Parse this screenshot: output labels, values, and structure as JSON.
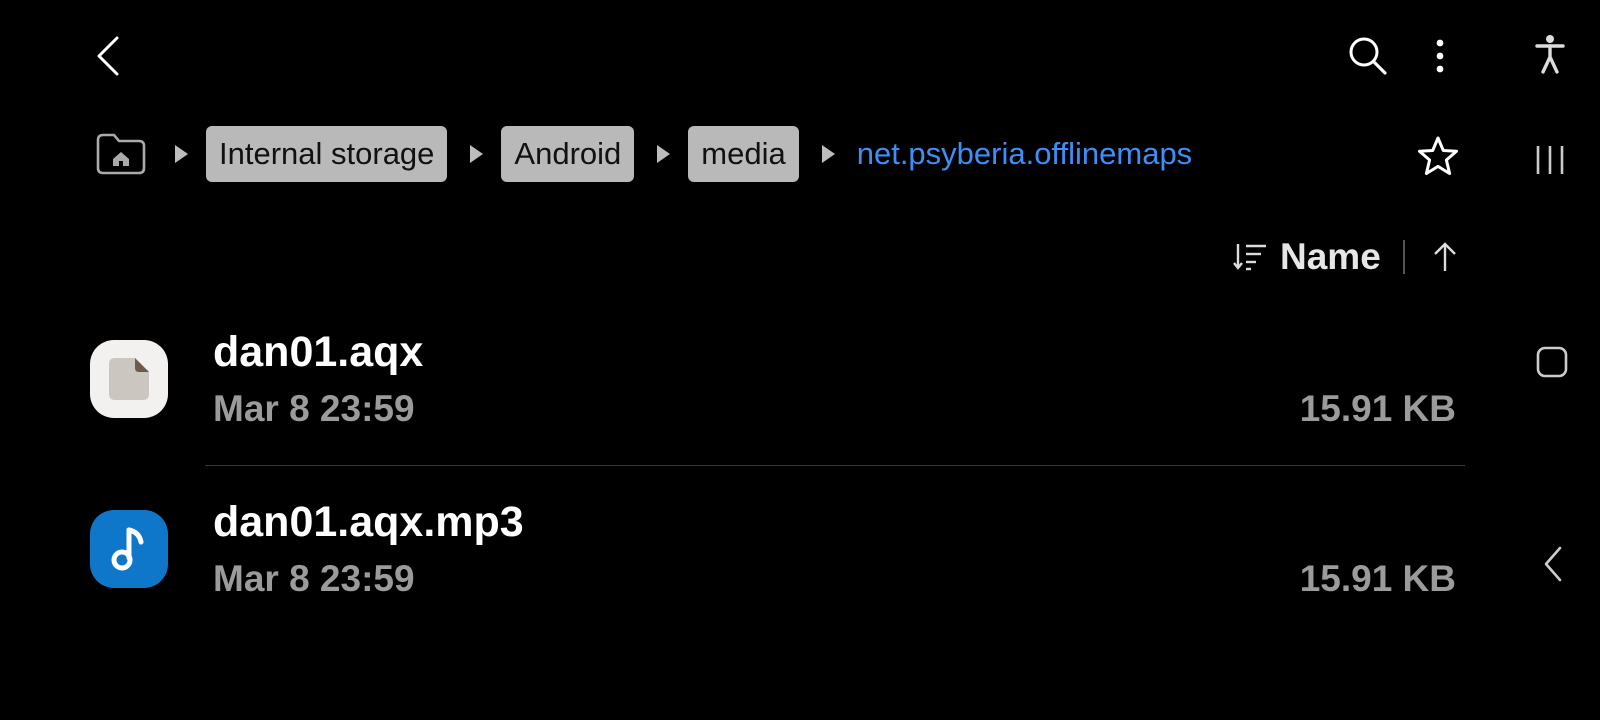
{
  "toolbar": {
    "back_icon": "chevron-left-icon",
    "search_icon": "search-icon",
    "more_icon": "more-vert-icon",
    "accessibility_icon": "accessibility-icon"
  },
  "breadcrumb": {
    "home_icon": "folder-home-icon",
    "items": [
      {
        "label": "Internal storage"
      },
      {
        "label": "Android"
      },
      {
        "label": "media"
      },
      {
        "label": "net.psyberia.offlinemaps",
        "current": true
      }
    ],
    "favorite_icon": "star-outline-icon"
  },
  "sort": {
    "label": "Name",
    "direction": "ascending"
  },
  "files": [
    {
      "name": "dan01.aqx",
      "date": "Mar 8 23:59",
      "size": "15.91 KB",
      "icon": "document-icon"
    },
    {
      "name": "dan01.aqx.mp3",
      "date": "Mar 8 23:59",
      "size": "15.91 KB",
      "icon": "music-note-icon"
    }
  ],
  "system_nav": {
    "recents_icon": "recents-icon",
    "home_icon": "home-icon",
    "back_icon": "back-icon"
  },
  "colors": {
    "background": "#000000",
    "accent": "#3e8ef7",
    "crumb_bg": "#b9b9b9",
    "music_icon_bg": "#0f77c9"
  }
}
